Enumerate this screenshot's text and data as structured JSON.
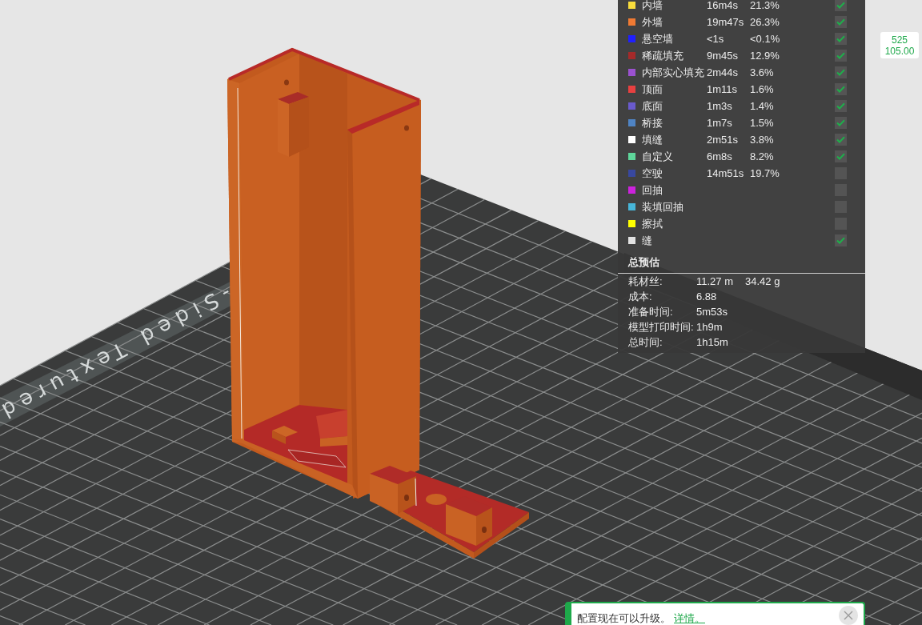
{
  "viewport": {
    "bed_label": "-Sided Textured"
  },
  "legend": {
    "rows": [
      {
        "name": "内墙",
        "time": "16m4s",
        "percent": "21.3%",
        "color": "#f8dc3c",
        "checked": true
      },
      {
        "name": "外墙",
        "time": "19m47s",
        "percent": "26.3%",
        "color": "#f07a33",
        "checked": true
      },
      {
        "name": "悬空墙",
        "time": "<1s",
        "percent": "<0.1%",
        "color": "#1f1fff",
        "checked": true
      },
      {
        "name": "稀疏填充",
        "time": "9m45s",
        "percent": "12.9%",
        "color": "#a52a2a",
        "checked": true
      },
      {
        "name": "内部实心填充",
        "time": "2m44s",
        "percent": "3.6%",
        "color": "#9b51d0",
        "checked": true
      },
      {
        "name": "顶面",
        "time": "1m11s",
        "percent": "1.6%",
        "color": "#e84040",
        "checked": true
      },
      {
        "name": "底面",
        "time": "1m3s",
        "percent": "1.4%",
        "color": "#6a5acd",
        "checked": true
      },
      {
        "name": "桥接",
        "time": "1m7s",
        "percent": "1.5%",
        "color": "#4f84c4",
        "checked": true
      },
      {
        "name": "填缝",
        "time": "2m51s",
        "percent": "3.8%",
        "color": "#ffffff",
        "checked": true
      },
      {
        "name": "自定义",
        "time": "6m8s",
        "percent": "8.2%",
        "color": "#5ed69a",
        "checked": true
      },
      {
        "name": "空驶",
        "time": "14m51s",
        "percent": "19.7%",
        "color": "#3848a0",
        "checked": false
      },
      {
        "name": "回抽",
        "color": "#cc22dd",
        "checked": false
      },
      {
        "name": "装填回抽",
        "color": "#47b6d9",
        "checked": false
      },
      {
        "name": "擦拭",
        "color": "#ffff00",
        "checked": false
      },
      {
        "name": "缝",
        "color": "#e2e2e2",
        "checked": true
      }
    ]
  },
  "summary": {
    "title": "总预估",
    "rows": [
      {
        "label": "耗材丝:",
        "value": "11.27 m",
        "value_2": "34.42 g"
      },
      {
        "label": "成本:",
        "value": "6.88"
      },
      {
        "label": "准备时间:",
        "value": "5m53s"
      },
      {
        "label": "模型打印时间:",
        "value": "1h9m"
      },
      {
        "label": "总时间:",
        "value": "1h15m"
      }
    ]
  },
  "layer_tag": {
    "lines": [
      "525",
      "105.00"
    ]
  },
  "notification": {
    "message": "配置现在可以升级。",
    "link": "详情。"
  }
}
